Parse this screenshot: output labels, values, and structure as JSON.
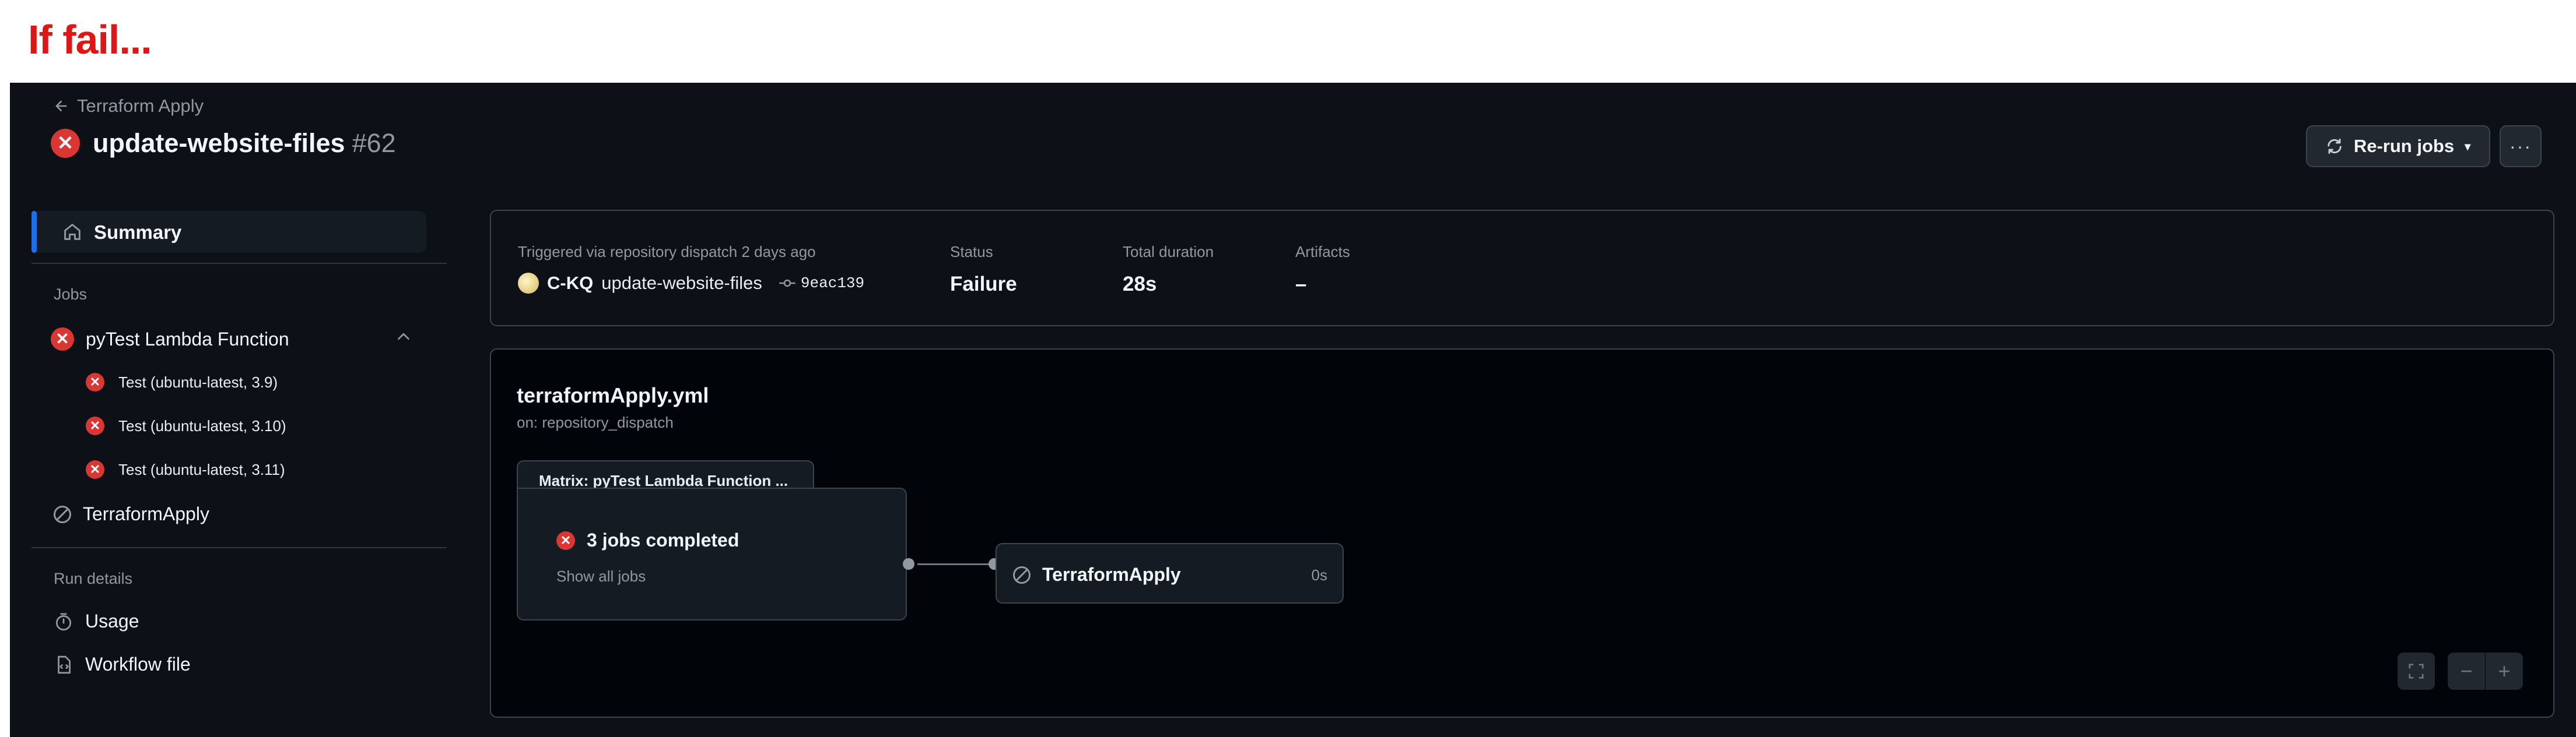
{
  "caption": "If fail...",
  "header": {
    "back_label": "Terraform Apply",
    "run_title": "update-website-files",
    "run_number": "#62",
    "rerun_label": "Re-run jobs"
  },
  "sidebar": {
    "summary_label": "Summary",
    "jobs_heading": "Jobs",
    "job_group_label": "pyTest Lambda Function",
    "sub_jobs": [
      {
        "label": "Test (ubuntu-latest, 3.9)"
      },
      {
        "label": "Test (ubuntu-latest, 3.10)"
      },
      {
        "label": "Test (ubuntu-latest, 3.11)"
      }
    ],
    "terraform_job_label": "TerraformApply",
    "run_details_heading": "Run details",
    "usage_label": "Usage",
    "workflow_file_label": "Workflow file"
  },
  "summary": {
    "trigger_text": "Triggered via repository dispatch 2 days ago",
    "actor": "C-KQ",
    "branch": "update-website-files",
    "commit": "9eac139",
    "status_label": "Status",
    "status_value": "Failure",
    "duration_label": "Total duration",
    "duration_value": "28s",
    "artifacts_label": "Artifacts",
    "artifacts_value": "–"
  },
  "graph": {
    "workflow_file": "terraformApply.yml",
    "trigger": "on: repository_dispatch",
    "matrix_tab": "Matrix: pyTest Lambda Function ...",
    "matrix_status": "3 jobs completed",
    "show_all": "Show all jobs",
    "terraform_job": "TerraformApply",
    "terraform_duration": "0s"
  },
  "colors": {
    "background": "#0d1117",
    "failure": "#da3633",
    "accent": "#1f6feb",
    "caption": "#e01515"
  }
}
